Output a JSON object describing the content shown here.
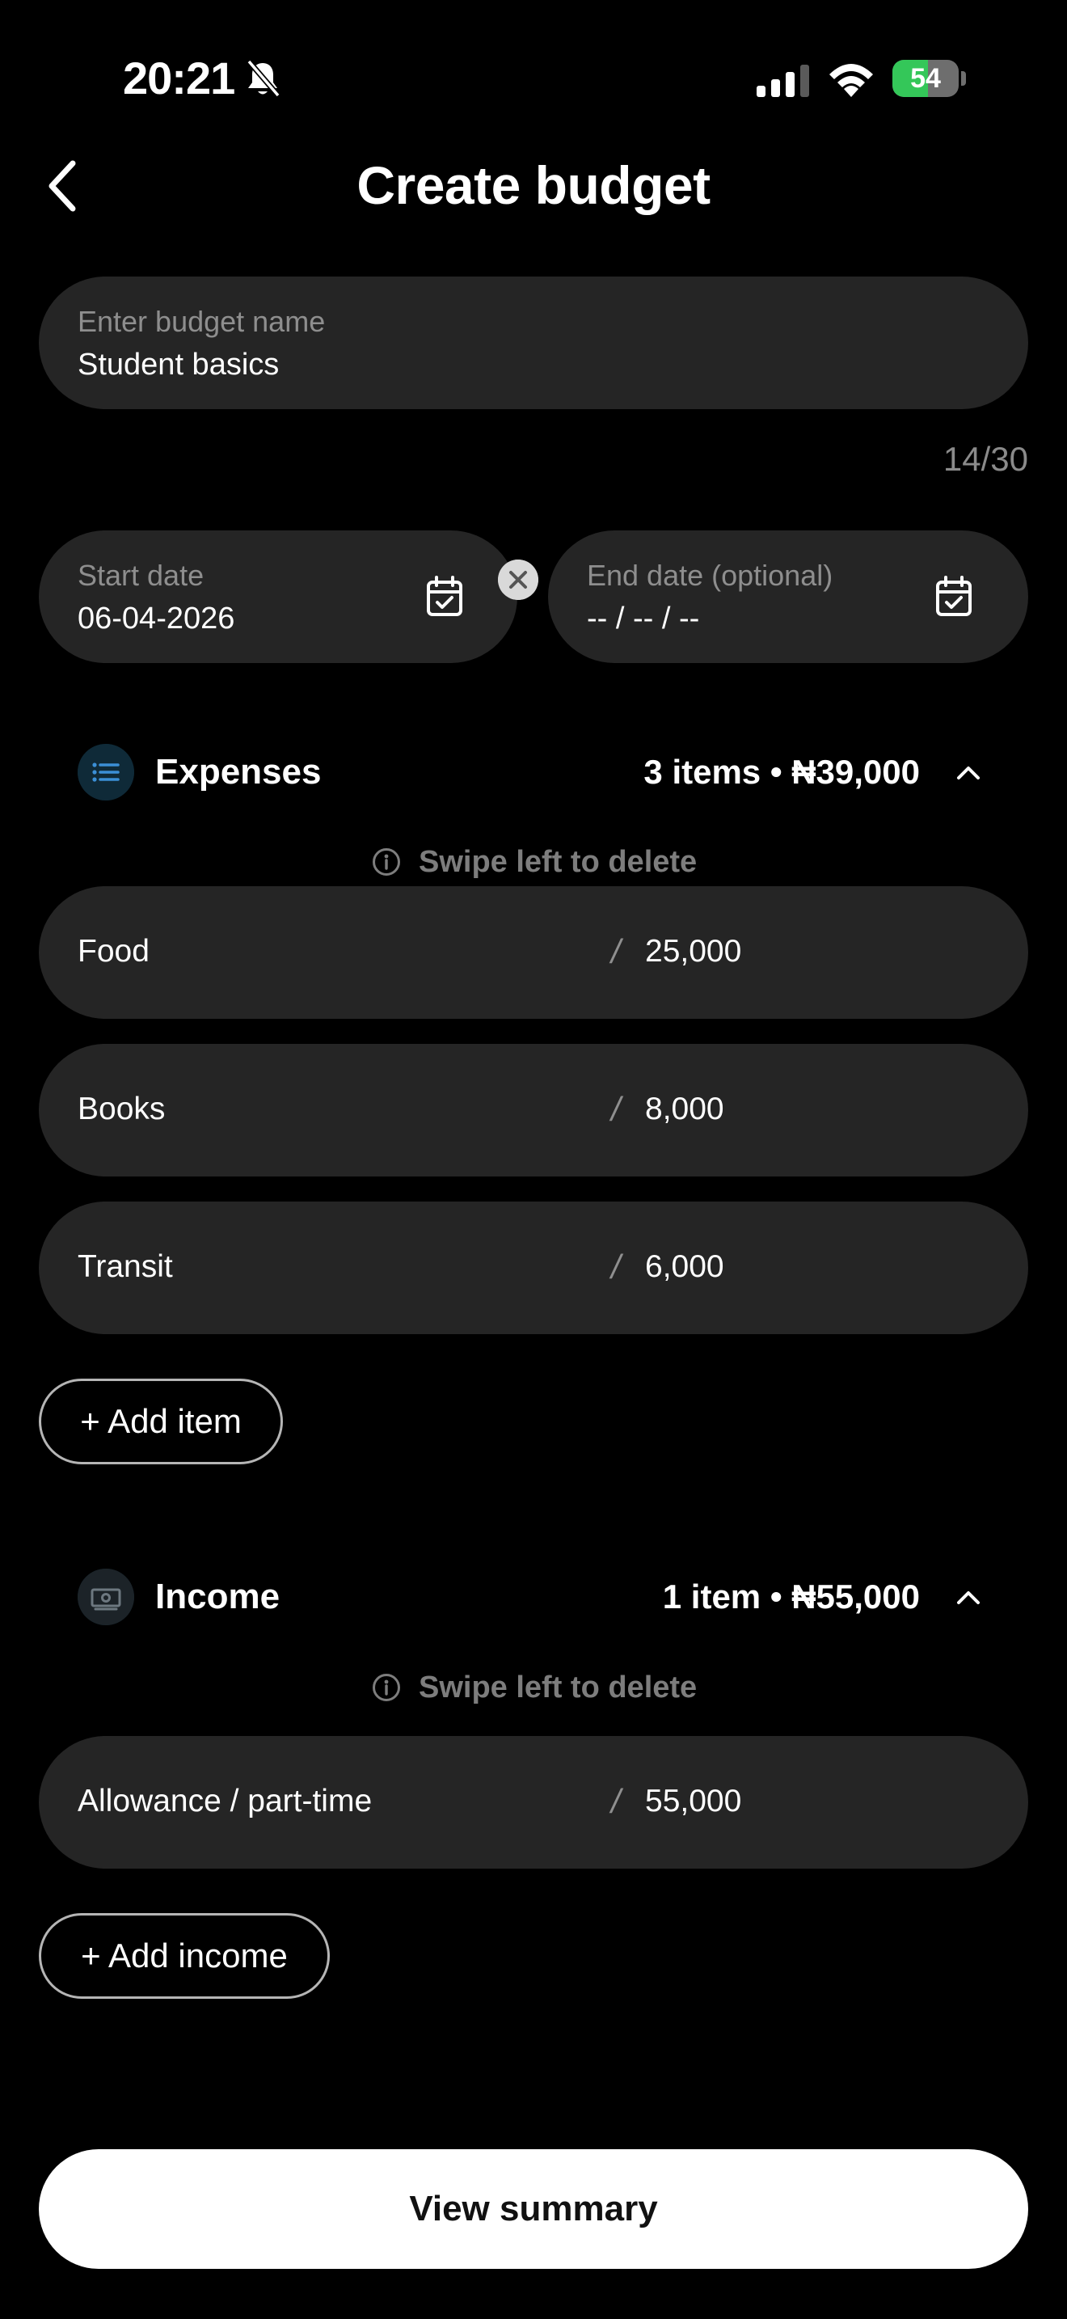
{
  "status_bar": {
    "time": "20:21",
    "battery_level": "54",
    "battery_fraction": 0.54,
    "icons": [
      "bell-slash-icon",
      "signal-icon",
      "wifi-icon",
      "battery-charging-icon"
    ]
  },
  "header": {
    "title": "Create budget",
    "back_icon": "chevron-left-icon"
  },
  "budget_name": {
    "placeholder": "Enter budget name",
    "value": "Student basics",
    "counter": "14/30"
  },
  "dates": {
    "start_label": "Start date",
    "start_value": "06-04-2026",
    "end_label": "End date (optional)",
    "end_value": "-- / -- / --",
    "icon": "calendar-check-icon",
    "clear_icon": "clear-x-icon"
  },
  "expenses": {
    "title": "Expenses",
    "summary": "3 items • ₦39,000",
    "icon": "list-icon",
    "hint": "Swipe left to delete",
    "items": [
      {
        "label": "Food",
        "amount": "25,000"
      },
      {
        "label": "Books",
        "amount": "8,000"
      },
      {
        "label": "Transit",
        "amount": "6,000"
      }
    ],
    "add_label": "+ Add item"
  },
  "income": {
    "title": "Income",
    "summary": "1 item • ₦55,000",
    "icon": "cash-icon",
    "hint": "Swipe left to delete",
    "items": [
      {
        "label": "Allowance / part-time",
        "amount": "55,000"
      }
    ],
    "add_label": "+ Add income"
  },
  "separator": "/",
  "footer": {
    "primary_label": "View summary"
  },
  "colors": {
    "background": "#000000",
    "surface": "#252525",
    "accent_blue": "#3b8fd6",
    "battery_green": "#34c759"
  }
}
